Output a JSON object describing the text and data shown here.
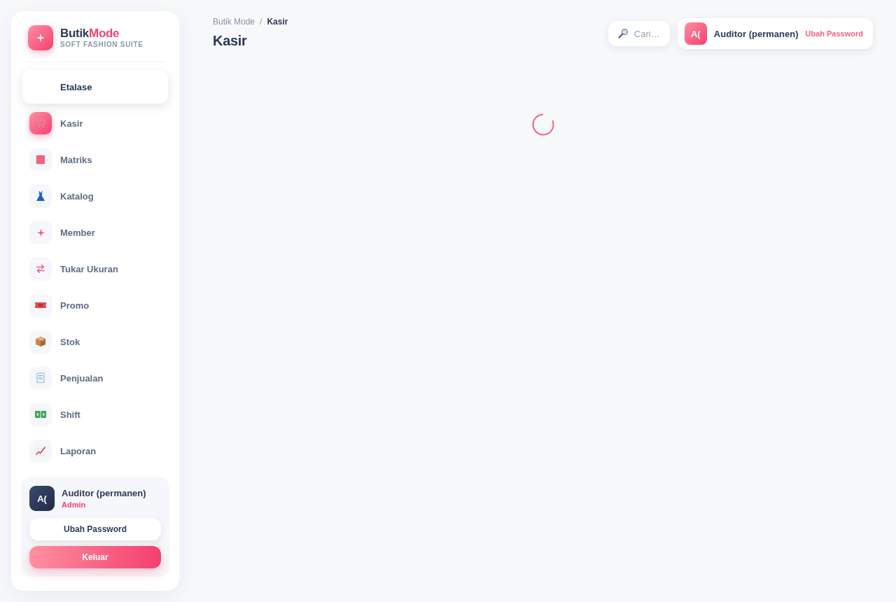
{
  "brand": {
    "name": "Butik",
    "name_accent": "Mode",
    "tagline": "SOFT FASHION SUITE"
  },
  "nav": {
    "items": [
      {
        "label": "Etalase",
        "selected": false,
        "hovered": true
      },
      {
        "label": "Kasir",
        "selected": true,
        "hovered": false
      },
      {
        "label": "Matriks",
        "selected": false,
        "hovered": false
      },
      {
        "label": "Katalog",
        "selected": false,
        "hovered": false
      },
      {
        "label": "Member",
        "selected": false,
        "hovered": false
      },
      {
        "label": "Tukar Ukuran",
        "selected": false,
        "hovered": false
      },
      {
        "label": "Promo",
        "selected": false,
        "hovered": false
      },
      {
        "label": "Stok",
        "selected": false,
        "hovered": false
      },
      {
        "label": "Penjualan",
        "selected": false,
        "hovered": false
      },
      {
        "label": "Shift",
        "selected": false,
        "hovered": false
      },
      {
        "label": "Laporan",
        "selected": false,
        "hovered": false
      }
    ]
  },
  "profile": {
    "avatar": "A(",
    "name": "Auditor (permanen)",
    "role": "Admin",
    "buttons": [
      {
        "label": "Ubah Password",
        "kind": "secondary"
      },
      {
        "label": "Keluar",
        "kind": "primary"
      }
    ]
  },
  "breadcrumb": {
    "items": [
      "Butik Mode",
      "Kasir"
    ],
    "separator": "/"
  },
  "page_title": "Kasir",
  "search": {
    "placeholder": "Cari…"
  },
  "user": {
    "avatar": "A(",
    "name": "Auditor (permanen)",
    "link": "Ubah Password"
  },
  "content": {
    "loading": true
  }
}
